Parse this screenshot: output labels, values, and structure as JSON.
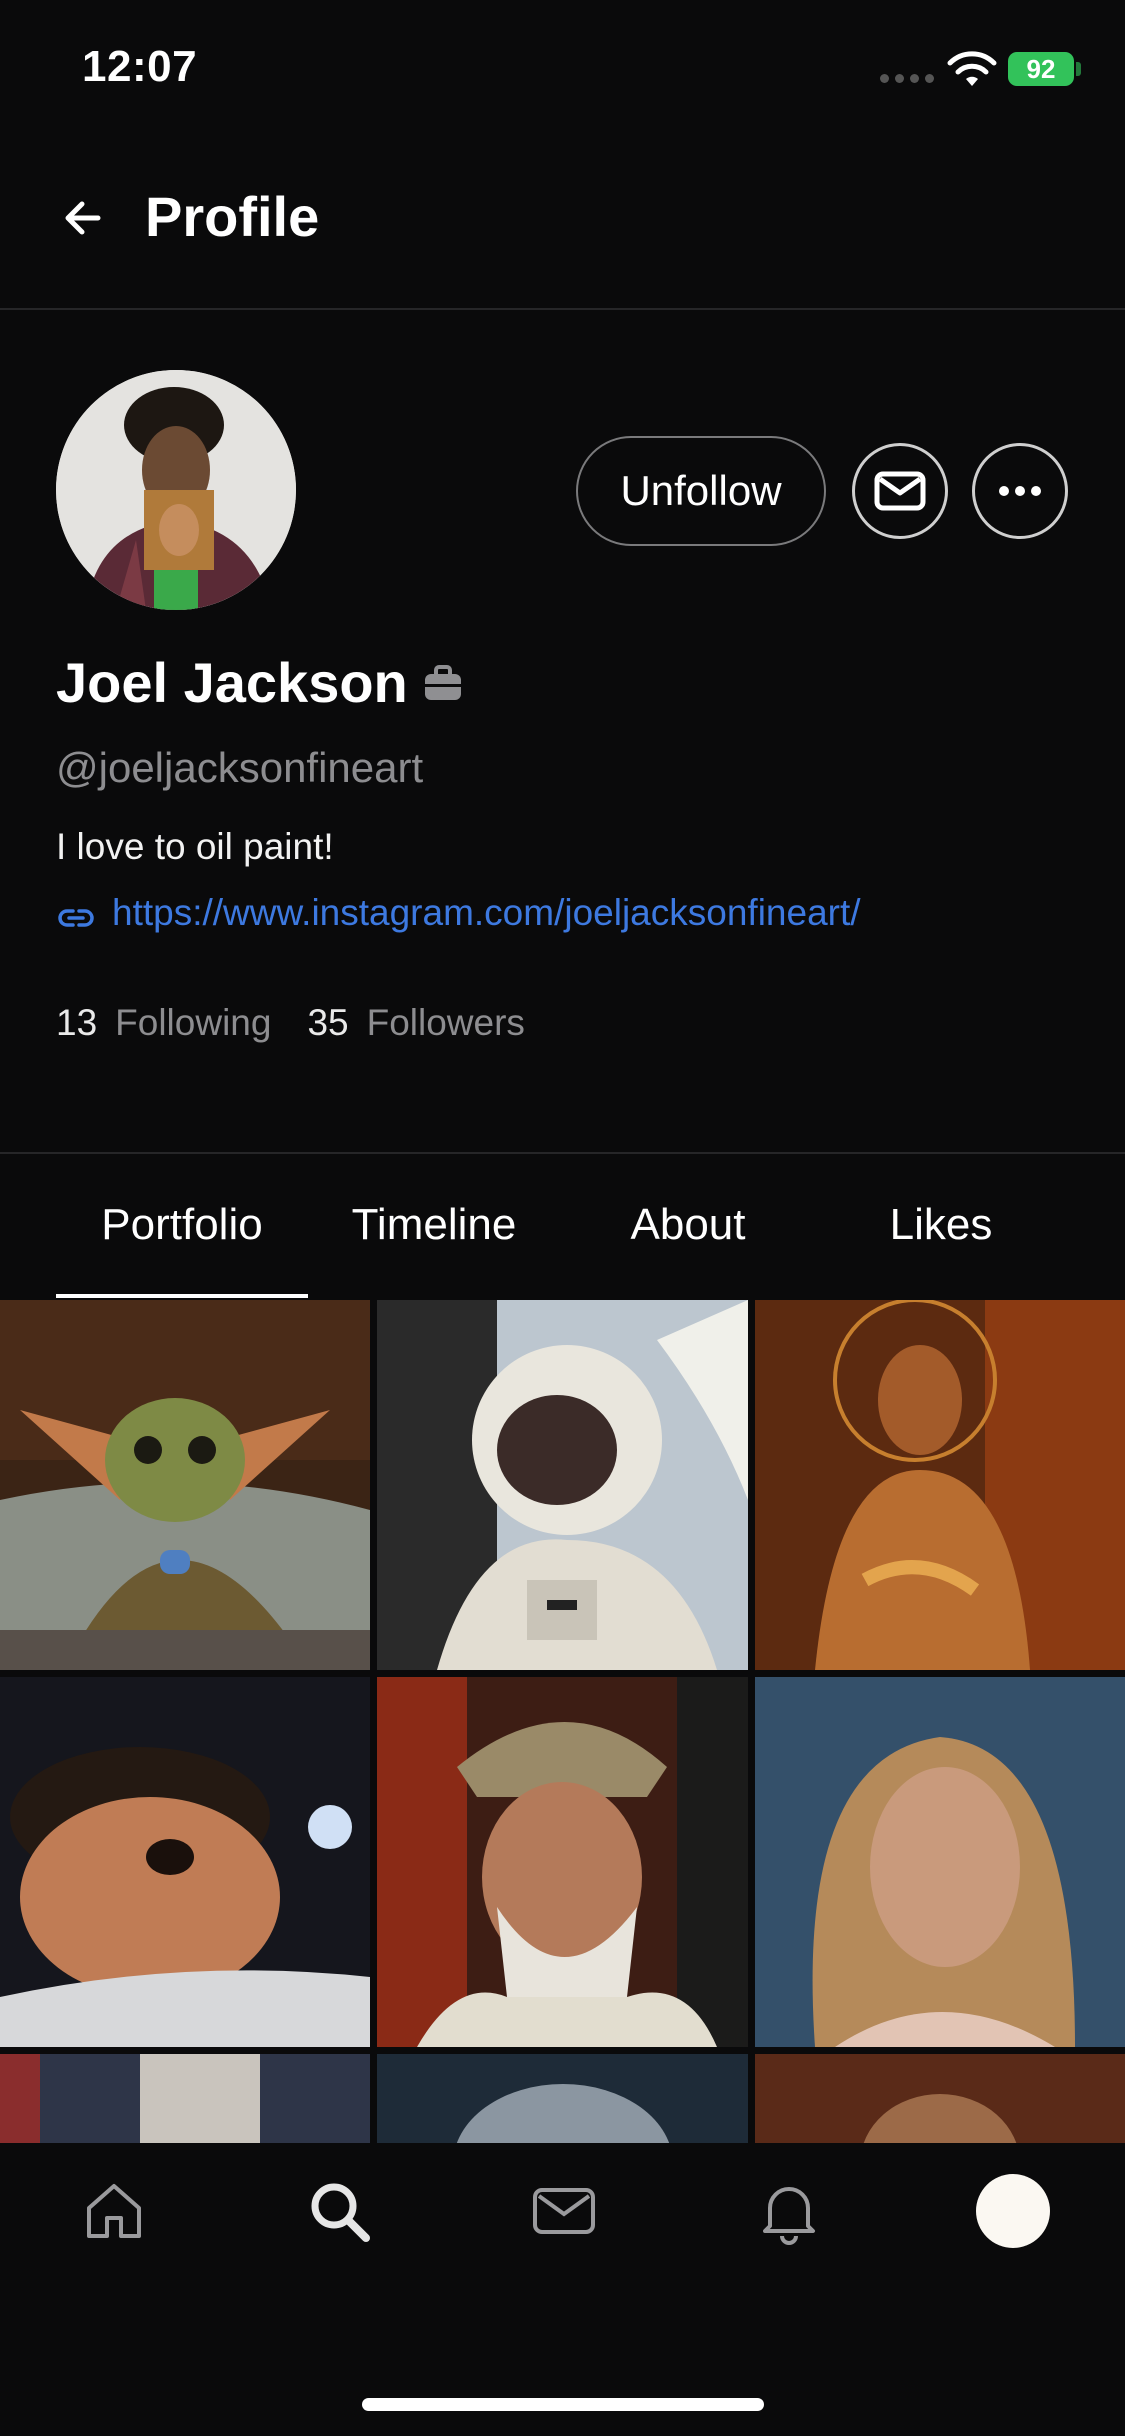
{
  "status_bar": {
    "time": "12:07",
    "battery": "92"
  },
  "header": {
    "title": "Profile"
  },
  "profile": {
    "name": "Joel Jackson",
    "handle": "@joeljacksonfineart",
    "bio": "I love to oil paint!",
    "link": "https://www.instagram.com/joeljacksonfineart/",
    "following_count": "13",
    "following_label": "Following",
    "followers_count": "35",
    "followers_label": "Followers"
  },
  "actions": {
    "unfollow_label": "Unfollow"
  },
  "tabs": [
    {
      "label": "Portfolio"
    },
    {
      "label": "Timeline"
    },
    {
      "label": "About"
    },
    {
      "label": "Likes"
    }
  ],
  "nav": {
    "items": [
      "home-icon",
      "search-icon",
      "mail-icon",
      "bell-icon",
      "profile-avatar"
    ]
  },
  "colors": {
    "accent_link": "#3d79e0",
    "background": "#0a0a0b",
    "battery": "#32c25a"
  }
}
